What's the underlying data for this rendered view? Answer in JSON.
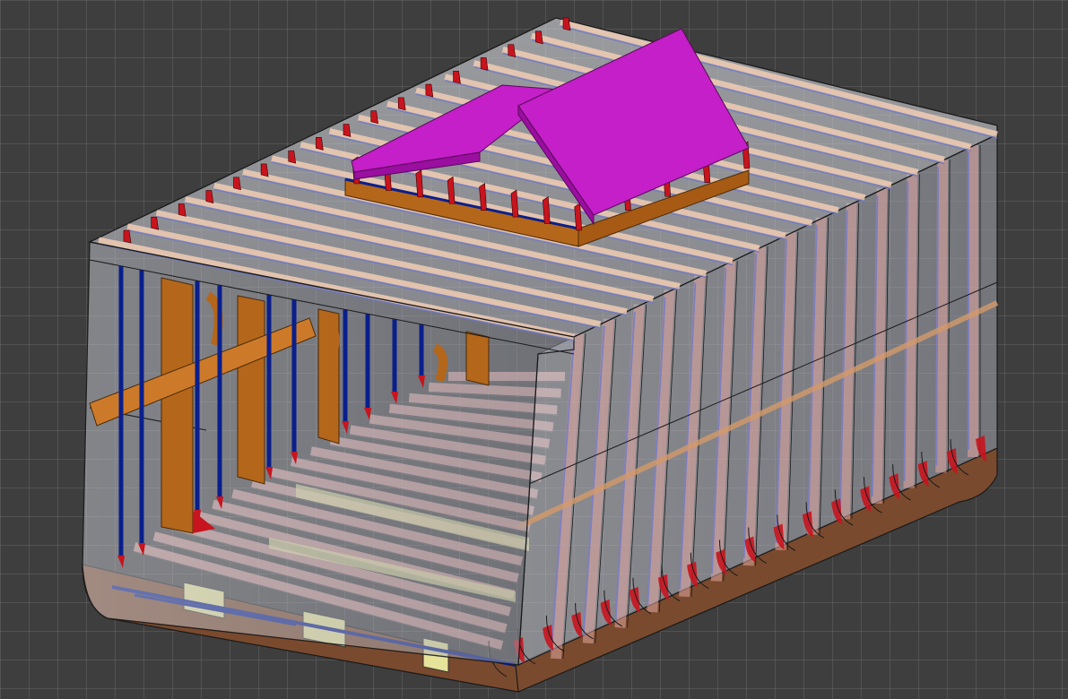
{
  "viewport": {
    "background_color": "#3e3e3e",
    "grid_color": "#5a5a5a"
  },
  "model": {
    "colors": {
      "shell_plate": "#b9bcc6",
      "shell_outline": "#1a1a1a",
      "transverse_frame": "#e3a7a2",
      "longitudinal_stiffener": "#0a1f8c",
      "web_frame": "#b4661a",
      "bracket": "#c8141e",
      "hatch_cover": "#c41fc8",
      "hatch_cover_dark": "#9a0ea0",
      "bottom_girder": "#e6e39a",
      "bilge_keel": "#7a4a2e",
      "deck_beam": "#f1cdb4"
    },
    "counts": {
      "deck_transverses": 17,
      "side_frames": 14,
      "bottom_floors": 17,
      "hatch_brackets": 12
    }
  }
}
